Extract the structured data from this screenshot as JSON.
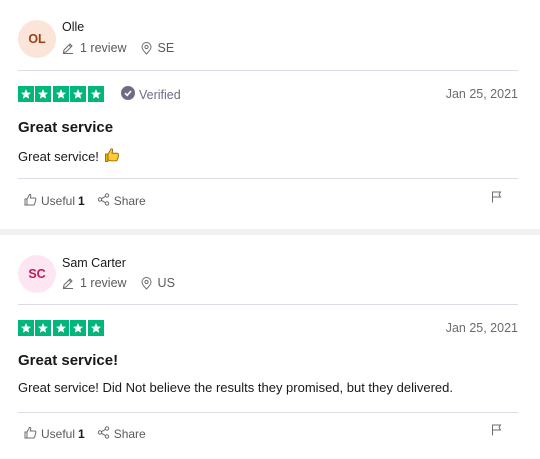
{
  "reviews": [
    {
      "avatar_initials": "OL",
      "avatar_bg": "#fbe5d8",
      "avatar_color": "#9b3f1c",
      "reviewer_name": "Olle",
      "review_count": "1 review",
      "country": "SE",
      "rating": 5,
      "verified_label": "Verified",
      "date": "Jan 25, 2021",
      "title": "Great service",
      "body": "Great service!",
      "body_emoji": "thumbs-up-emoji",
      "useful_label": "Useful",
      "useful_count": "1",
      "share_label": "Share"
    },
    {
      "avatar_initials": "SC",
      "avatar_bg": "#fde6f1",
      "avatar_color": "#c0185d",
      "reviewer_name": "Sam Carter",
      "review_count": "1 review",
      "country": "US",
      "rating": 5,
      "date": "Jan 25, 2021",
      "title": "Great service!",
      "body": "Great service! Did Not believe the results they promised, but they delivered.",
      "useful_label": "Useful",
      "useful_count": "1",
      "share_label": "Share"
    }
  ],
  "colors": {
    "star_green": "#00b67a",
    "divider": "#dcdce6",
    "section_separator": "#f1f1f2"
  },
  "icons": [
    "pencil-icon",
    "location-pin-icon",
    "star-icon",
    "verified-check-icon",
    "thumbs-up-icon",
    "share-icon",
    "flag-icon"
  ]
}
